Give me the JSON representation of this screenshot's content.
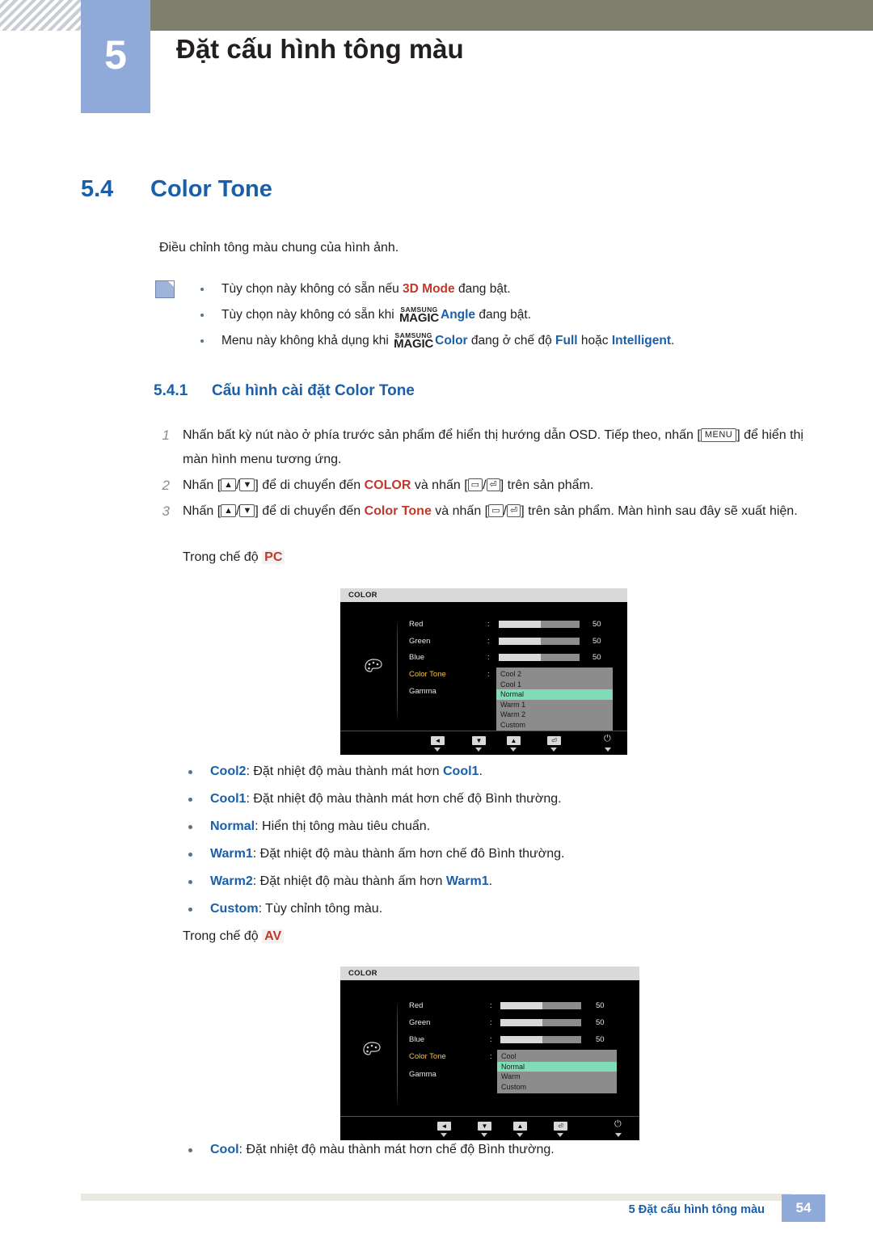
{
  "header": {
    "chapter_number": "5",
    "chapter_title": "Đặt cấu hình tông màu"
  },
  "section": {
    "number": "5.4",
    "title": "Color Tone"
  },
  "intro": "Điều chỉnh tông màu chung của hình ảnh.",
  "notes": [
    {
      "pre": "Tùy chọn này không có sẵn nếu ",
      "highlight": "3D Mode",
      "post": " đang bật."
    },
    {
      "pre": "Tùy chọn này không có sẵn khi ",
      "magic": "SAMSUNG MAGIC",
      "highlight": "Angle",
      "post": " đang bật."
    },
    {
      "pre": "Menu này không khả dụng khi ",
      "magic": "SAMSUNG MAGIC",
      "highlight": "Color",
      "mid": " đang ở chế độ ",
      "opt1": "Full",
      "mid2": " hoặc ",
      "opt2": "Intelligent",
      "post": "."
    }
  ],
  "subsection": {
    "number": "5.4.1",
    "title": "Cấu hình cài đặt Color Tone"
  },
  "steps": [
    {
      "num": "1",
      "part1": "Nhấn bất kỳ nút nào ở phía trước sản phẩm để hiển thị hướng dẫn OSD. Tiếp theo, nhấn [",
      "key": "MENU",
      "part2": "] để hiển thị màn hình menu tương ứng."
    },
    {
      "num": "2",
      "part1": "Nhấn [",
      "sym1": "▲",
      "sep": "/",
      "sym2": "▼",
      "part2": "] để di chuyển đến ",
      "target": "COLOR",
      "part3": " và nhấn [",
      "sym3": "▭",
      "sym4": "⏎",
      "part4": "] trên sản phẩm."
    },
    {
      "num": "3",
      "part1": "Nhấn [",
      "sym1": "▲",
      "sep": "/",
      "sym2": "▼",
      "part2": "] để di chuyển đến ",
      "target": "Color Tone",
      "part3": " và nhấn [",
      "sym3": "▭",
      "sym4": "⏎",
      "part4": "] trên sản phẩm. Màn hình sau đây sẽ xuất hiện."
    }
  ],
  "pc_mode_label": "Trong chế độ ",
  "pc_mode_tag": "PC",
  "av_mode_label": "Trong chế độ ",
  "av_mode_tag": "AV",
  "osd_pc": {
    "title": "COLOR",
    "rows": [
      {
        "label": "Red",
        "value": "50",
        "fill": 0.52
      },
      {
        "label": "Green",
        "value": "50",
        "fill": 0.52
      },
      {
        "label": "Blue",
        "value": "50",
        "fill": 0.52
      }
    ],
    "color_tone_label": "Color Tone",
    "gamma_label": "Gamma",
    "menu_items": [
      "Cool 2",
      "Cool 1",
      "Normal",
      "Warm 1",
      "Warm 2",
      "Custom"
    ],
    "menu_selected": "Normal",
    "footer_buttons": [
      "◄",
      "▼",
      "▲",
      "⏎"
    ],
    "power_symbol": "⏻"
  },
  "osd_av": {
    "title": "COLOR",
    "rows": [
      {
        "label": "Red",
        "value": "50",
        "fill": 0.52
      },
      {
        "label": "Green",
        "value": "50",
        "fill": 0.52
      },
      {
        "label": "Blue",
        "value": "50",
        "fill": 0.52
      }
    ],
    "color_tone_label": "Color Tone",
    "gamma_label": "Gamma",
    "menu_items": [
      "Cool",
      "Normal",
      "Warm",
      "Custom"
    ],
    "menu_selected": "Normal",
    "footer_buttons": [
      "◄",
      "▼",
      "▲",
      "⏎"
    ],
    "power_symbol": "⏻"
  },
  "pc_list": [
    {
      "term": "Cool2",
      "desc": ": Đặt nhiệt độ màu thành mát hơn ",
      "term2": "Cool1",
      "tail": "."
    },
    {
      "term": "Cool1",
      "desc": ": Đặt nhiệt độ màu thành mát hơn chế độ Bình thường.",
      "term2": "",
      "tail": ""
    },
    {
      "term": "Normal",
      "desc": ": Hiển thị tông màu tiêu chuẩn.",
      "term2": "",
      "tail": ""
    },
    {
      "term": "Warm1",
      "desc": ": Đặt nhiệt độ màu thành ấm hơn chế đô Bình thường.",
      "term2": "",
      "tail": ""
    },
    {
      "term": "Warm2",
      "desc": ": Đặt nhiệt độ màu thành ấm hơn ",
      "term2": "Warm1",
      "tail": "."
    },
    {
      "term": "Custom",
      "desc": ": Tùy chỉnh tông màu.",
      "term2": "",
      "tail": ""
    }
  ],
  "av_list": [
    {
      "term": "Cool",
      "desc": ": Đặt nhiệt độ màu thành mát hơn chế độ Bình thường.",
      "term2": "",
      "tail": ""
    }
  ],
  "footer": {
    "text": "5 Đặt cấu hình tông màu",
    "page": "54"
  },
  "colors": {
    "accent_blue": "#1b5fa8",
    "chapter_blue": "#8fa9d8",
    "header_band": "#807f6d",
    "red": "#c0392b",
    "osd_highlight": "#7fdcb6",
    "osd_selected_text": "#f5c242"
  }
}
